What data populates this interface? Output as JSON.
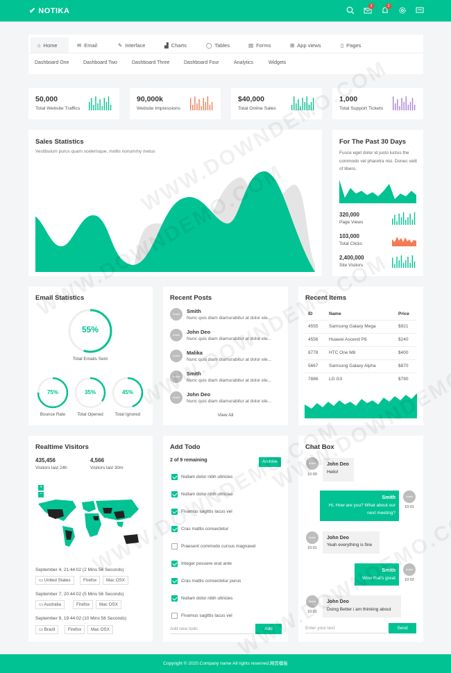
{
  "header": {
    "brand": "NOTIKA",
    "mail_badge": "3",
    "bell_badge": "3"
  },
  "nav": {
    "tabs": [
      {
        "label": "Home"
      },
      {
        "label": "Email"
      },
      {
        "label": "Interface"
      },
      {
        "label": "Charts"
      },
      {
        "label": "Tables"
      },
      {
        "label": "Forms"
      },
      {
        "label": "App views"
      },
      {
        "label": "Pages"
      }
    ],
    "subtabs": [
      "Dashboard One",
      "Dashboard Two",
      "Dashboard Three",
      "Dashboard Four",
      "Analytics",
      "Widgets"
    ]
  },
  "stats": [
    {
      "value": "50,000",
      "label": "Total Website Traffics",
      "color": "#00c292"
    },
    {
      "value": "90,000k",
      "label": "Website Impressions",
      "color": "#f37b53"
    },
    {
      "value": "$40,000",
      "label": "Total Online Sales",
      "color": "#00c292"
    },
    {
      "value": "1,000",
      "label": "Total Support Tickets",
      "color": "#a97fd6"
    }
  ],
  "sales": {
    "title": "Sales Statistics",
    "subtitle": "Vestibulum purus quam scelerisque, mollis nonummy metus"
  },
  "past30": {
    "title": "For The Past 30 Days",
    "text": "Fusce eget dolor id justo luctus the commodo vel pharetra nisi. Donec velit of libero.",
    "items": [
      {
        "value": "320,000",
        "label": "Page Views"
      },
      {
        "value": "103,000",
        "label": "Total Clicks"
      },
      {
        "value": "2,400,000",
        "label": "Site Visitors"
      }
    ]
  },
  "email": {
    "title": "Email Statistics",
    "main_pct": "55%",
    "main_label": "Total Emails Sent",
    "small": [
      {
        "pct": "75%",
        "label": "Bounce Rate"
      },
      {
        "pct": "35%",
        "label": "Total Opened"
      },
      {
        "pct": "45%",
        "label": "Total Ignored"
      }
    ]
  },
  "posts": {
    "title": "Recent Posts",
    "avatar_text": "Avatar",
    "items": [
      {
        "name": "Smith",
        "text": "Nunc quis diam diamurabitur at dolor ele..."
      },
      {
        "name": "John Deo",
        "text": "Nunc quis diam diamurabitur at dolor ele..."
      },
      {
        "name": "Malika",
        "text": "Nunc quis diam diamurabitur at dolor ele..."
      },
      {
        "name": "Smith",
        "text": "Nunc quis diam diamurabitur at dolor ele..."
      },
      {
        "name": "John Deo",
        "text": "Nunc quis diam diamurabitur at dolor ele..."
      }
    ],
    "view_all": "View All"
  },
  "items": {
    "title": "Recent Items",
    "headers": [
      "ID",
      "Name",
      "Price"
    ],
    "rows": [
      [
        "4555",
        "Samsung Galaxy Mega",
        "$921"
      ],
      [
        "4556",
        "Huawei Ascend P6",
        "$240"
      ],
      [
        "8778",
        "HTC One M8",
        "$400"
      ],
      [
        "5667",
        "Samsung Galaxy Alpha",
        "$870"
      ],
      [
        "7886",
        "LG G3",
        "$790"
      ]
    ]
  },
  "visitors": {
    "title": "Realtime Visitors",
    "stats": [
      {
        "value": "435,456",
        "label": "Visitors last 24h"
      },
      {
        "value": "4,566",
        "label": "Visitors last 30m"
      }
    ],
    "map_zoom_in": "+",
    "map_zoom_out": "−",
    "sessions": [
      {
        "time": "September 4, 21:44:02 (2 Mins 56 Seconds)",
        "tags": [
          "United States",
          "Firefox",
          "Mac OSX"
        ]
      },
      {
        "time": "September 7, 20:44:02 (5 Mins 56 Seconds)",
        "tags": [
          "Australia",
          "Firefox",
          "Mac OSX"
        ]
      },
      {
        "time": "September 9, 19:44:02 (10 Mins 56 Seconds)",
        "tags": [
          "Brazil",
          "Firefox",
          "Mac OSX"
        ]
      }
    ]
  },
  "todo": {
    "title": "Add Todo",
    "remaining": "2 of 9 remaining",
    "archive": "Archive",
    "items": [
      {
        "text": "Nullam dolor nibh ultricies",
        "done": true
      },
      {
        "text": "Nullam dolor nibh ultricies",
        "done": true
      },
      {
        "text": "Fivamus sagittis lacus vel",
        "done": true
      },
      {
        "text": "Cras mattis consectetur",
        "done": true
      },
      {
        "text": "Praesent commodo cursus magnavel",
        "done": false
      },
      {
        "text": "Integer posuere erat ante",
        "done": true
      },
      {
        "text": "Cras mattis consectetur purus",
        "done": true
      },
      {
        "text": "Nullam dolor nibh ultricies",
        "done": true
      },
      {
        "text": "Fivamus sagittis lacus vel",
        "done": false
      }
    ],
    "placeholder": "Add new todo",
    "add": "Add"
  },
  "chat": {
    "title": "Chat Box",
    "avatar_text": "Avatar",
    "messages": [
      {
        "name": "John Deo",
        "text": "Hello!",
        "time": "10:00",
        "side": "left"
      },
      {
        "name": "Smith",
        "text": "Hi, How are you? What about our next meeting?",
        "time": "10:01",
        "side": "right"
      },
      {
        "name": "John Deo",
        "text": "Yeah everything is fine",
        "time": "10:01",
        "side": "left"
      },
      {
        "name": "Smith",
        "text": "Wow that's great",
        "time": "10:02",
        "side": "right"
      },
      {
        "name": "John Deo",
        "text": "Doing Better i am thinking about",
        "time": "10:01",
        "side": "left"
      }
    ],
    "placeholder": "Enter your text",
    "send": "Send"
  },
  "footer": {
    "text": "Copyright © 2020.Company name All rights reserved.网页模板"
  },
  "watermark": "WWW.DOWNDEMO.COM",
  "colors": {
    "accent": "#00c292",
    "orange": "#f37b53",
    "purple": "#a97fd6"
  }
}
